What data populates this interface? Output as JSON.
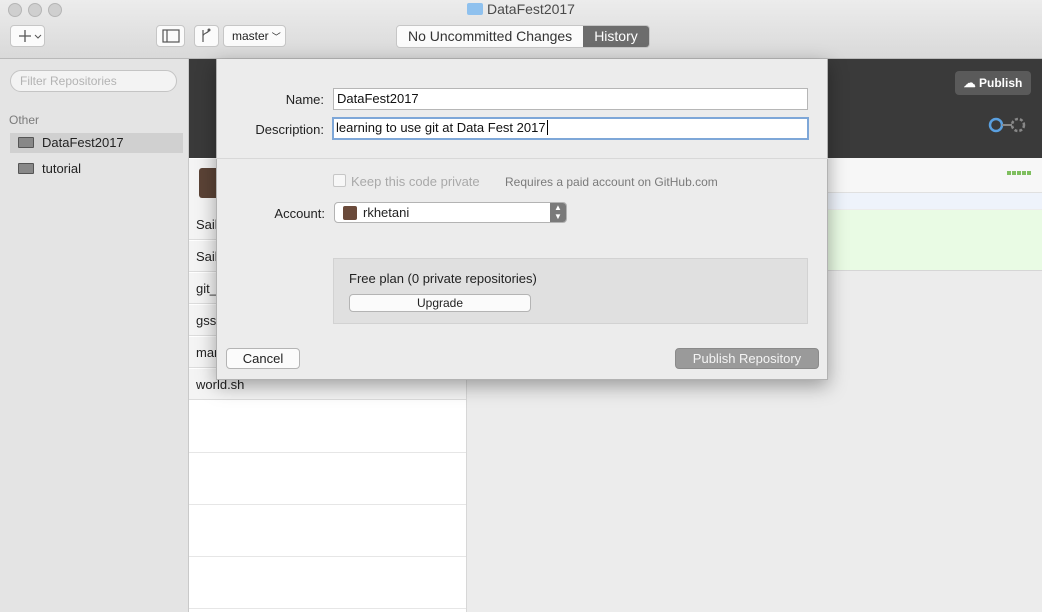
{
  "window": {
    "title": "DataFest2017"
  },
  "toolbar": {
    "branch": "master",
    "tabs": [
      "No Uncommitted Changes",
      "History"
    ],
    "active_tab": "History"
  },
  "sidebar": {
    "filter_placeholder": "Filter Repositories",
    "section": "Other",
    "repos": [
      {
        "name": "DataFest2017",
        "selected": true
      },
      {
        "name": "tutorial",
        "selected": false
      }
    ]
  },
  "file_list": [
    "Sail",
    "Sail",
    "git_",
    "gss",
    "mar",
    "world.sh"
  ],
  "right_pane": {
    "publish_label": "Publish"
  },
  "dialog": {
    "name_label": "Name:",
    "name_value": "DataFest2017",
    "description_label": "Description:",
    "description_value": "learning to use git at Data Fest 2017",
    "private_label": "Keep this code private",
    "private_note": "Requires a paid account on GitHub.com",
    "account_label": "Account:",
    "account_value": "rkhetani",
    "plan_text": "Free plan (0 private repositories)",
    "upgrade_label": "Upgrade",
    "cancel_label": "Cancel",
    "publish_label": "Publish Repository"
  }
}
